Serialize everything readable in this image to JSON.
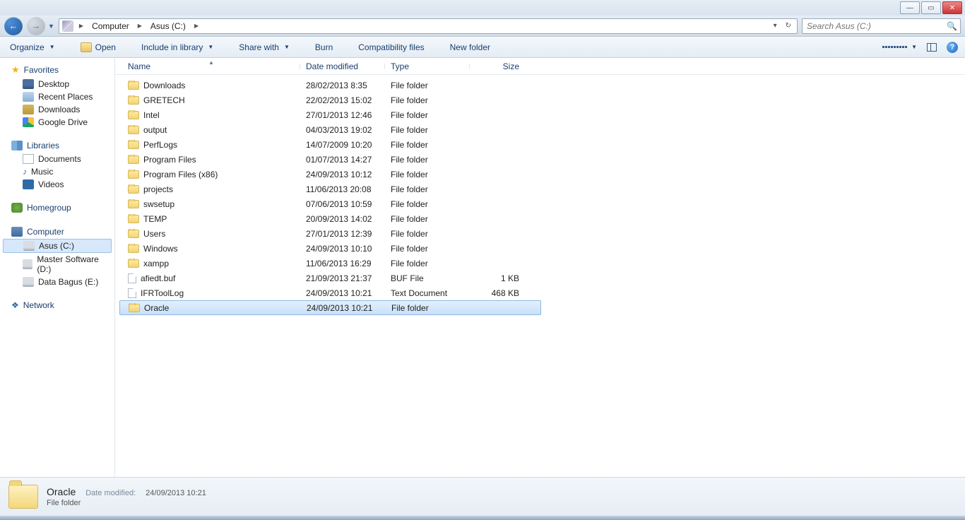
{
  "breadcrumb": [
    "Computer",
    "Asus (C:)"
  ],
  "search_placeholder": "Search Asus (C:)",
  "toolbar": {
    "organize": "Organize",
    "open": "Open",
    "include": "Include in library",
    "share": "Share with",
    "burn": "Burn",
    "compat": "Compatibility files",
    "newfolder": "New folder"
  },
  "side": {
    "favorites": "Favorites",
    "fav_items": [
      {
        "label": "Desktop",
        "ico": "ico-desktop"
      },
      {
        "label": "Recent Places",
        "ico": "ico-recent"
      },
      {
        "label": "Downloads",
        "ico": "ico-dl"
      },
      {
        "label": "Google Drive",
        "ico": "ico-gd"
      }
    ],
    "libraries": "Libraries",
    "lib_items": [
      {
        "label": "Documents",
        "ico": "ico-doc"
      },
      {
        "label": "Music",
        "ico": "ico-music",
        "glyph": "♪"
      },
      {
        "label": "Videos",
        "ico": "ico-video"
      }
    ],
    "homegroup": "Homegroup",
    "computer": "Computer",
    "comp_items": [
      {
        "label": "Asus (C:)",
        "ico": "ico-drive",
        "selected": true
      },
      {
        "label": "Master Software (D:)",
        "ico": "ico-drive"
      },
      {
        "label": "Data Bagus (E:)",
        "ico": "ico-drive"
      }
    ],
    "network": "Network"
  },
  "columns": {
    "name": "Name",
    "date": "Date modified",
    "type": "Type",
    "size": "Size"
  },
  "rows": [
    {
      "name": "Downloads",
      "date": "28/02/2013 8:35",
      "type": "File folder",
      "size": "",
      "kind": "folder"
    },
    {
      "name": "GRETECH",
      "date": "22/02/2013 15:02",
      "type": "File folder",
      "size": "",
      "kind": "folder"
    },
    {
      "name": "Intel",
      "date": "27/01/2013 12:46",
      "type": "File folder",
      "size": "",
      "kind": "folder"
    },
    {
      "name": "output",
      "date": "04/03/2013 19:02",
      "type": "File folder",
      "size": "",
      "kind": "folder"
    },
    {
      "name": "PerfLogs",
      "date": "14/07/2009 10:20",
      "type": "File folder",
      "size": "",
      "kind": "folder"
    },
    {
      "name": "Program Files",
      "date": "01/07/2013 14:27",
      "type": "File folder",
      "size": "",
      "kind": "folder"
    },
    {
      "name": "Program Files (x86)",
      "date": "24/09/2013 10:12",
      "type": "File folder",
      "size": "",
      "kind": "folder"
    },
    {
      "name": "projects",
      "date": "11/06/2013 20:08",
      "type": "File folder",
      "size": "",
      "kind": "folder"
    },
    {
      "name": "swsetup",
      "date": "07/06/2013 10:59",
      "type": "File folder",
      "size": "",
      "kind": "folder"
    },
    {
      "name": "TEMP",
      "date": "20/09/2013 14:02",
      "type": "File folder",
      "size": "",
      "kind": "folder"
    },
    {
      "name": "Users",
      "date": "27/01/2013 12:39",
      "type": "File folder",
      "size": "",
      "kind": "folder"
    },
    {
      "name": "Windows",
      "date": "24/09/2013 10:10",
      "type": "File folder",
      "size": "",
      "kind": "folder"
    },
    {
      "name": "xampp",
      "date": "11/06/2013 16:29",
      "type": "File folder",
      "size": "",
      "kind": "folder"
    },
    {
      "name": "afiedt.buf",
      "date": "21/09/2013 21:37",
      "type": "BUF File",
      "size": "1 KB",
      "kind": "file"
    },
    {
      "name": "IFRToolLog",
      "date": "24/09/2013 10:21",
      "type": "Text Document",
      "size": "468 KB",
      "kind": "file"
    },
    {
      "name": "Oracle",
      "date": "24/09/2013 10:21",
      "type": "File folder",
      "size": "",
      "kind": "folder",
      "selected": true
    }
  ],
  "details": {
    "name": "Oracle",
    "type": "File folder",
    "mod_label": "Date modified:",
    "mod_value": "24/09/2013 10:21"
  }
}
